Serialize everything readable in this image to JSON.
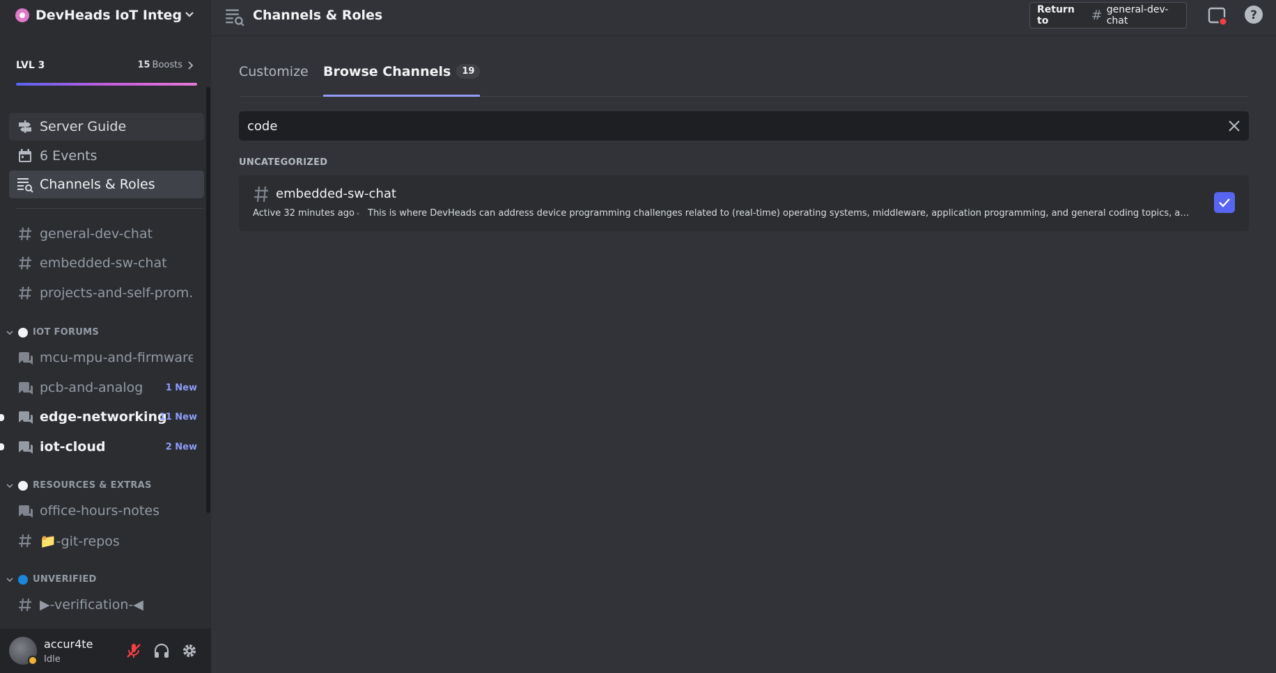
{
  "server": {
    "name": "DevHeads IoT Integra...",
    "level": "LVL 3",
    "boost_count": "15",
    "boost_label": "Boosts"
  },
  "nav": [
    {
      "label": "Server Guide",
      "icon": "signpost-icon"
    },
    {
      "label": "6 Events",
      "icon": "calendar-icon"
    },
    {
      "label": "Channels & Roles",
      "icon": "channel-browse-icon"
    }
  ],
  "channels_top": [
    {
      "label": "general-dev-chat"
    },
    {
      "label": "embedded-sw-chat"
    },
    {
      "label": "projects-and-self-prom..."
    }
  ],
  "categories": [
    {
      "label": "IOT FORUMS",
      "channels": [
        {
          "label": "mcu-mpu-and-firmware",
          "badge": ""
        },
        {
          "label": "pcb-and-analog",
          "badge": "1 New"
        },
        {
          "label": "edge-networking",
          "badge": "11 New"
        },
        {
          "label": "iot-cloud",
          "badge": "2 New"
        }
      ]
    },
    {
      "label": "RESOURCES & EXTRAS",
      "channels": [
        {
          "label": "office-hours-notes"
        },
        {
          "label": "📁-git-repos"
        }
      ]
    },
    {
      "label": "UNVERIFIED",
      "channels": [
        {
          "label": "▶-verification-◀"
        }
      ]
    }
  ],
  "user": {
    "name": "accur4te",
    "status": "Idle"
  },
  "topbar": {
    "title": "Channels & Roles",
    "return_label": "Return to",
    "return_channel": "general-dev-chat"
  },
  "tabs": [
    {
      "label": "Customize"
    },
    {
      "label": "Browse Channels",
      "badge": "19"
    }
  ],
  "search": {
    "value": "code"
  },
  "results": {
    "category": "UNCATEGORIZED",
    "items": [
      {
        "name": "embedded-sw-chat",
        "activity": "Active 32 minutes ago",
        "description": "This is where DevHeads can address device programming challenges related to (real-time) operating systems, middleware, application programming, and general coding topics, all in the s...",
        "checked": true
      }
    ]
  },
  "colors": {
    "accent": "#5865f2",
    "new_badge": "#8d9cf8",
    "idle": "#f0b232",
    "mute_red": "#f23f43"
  }
}
